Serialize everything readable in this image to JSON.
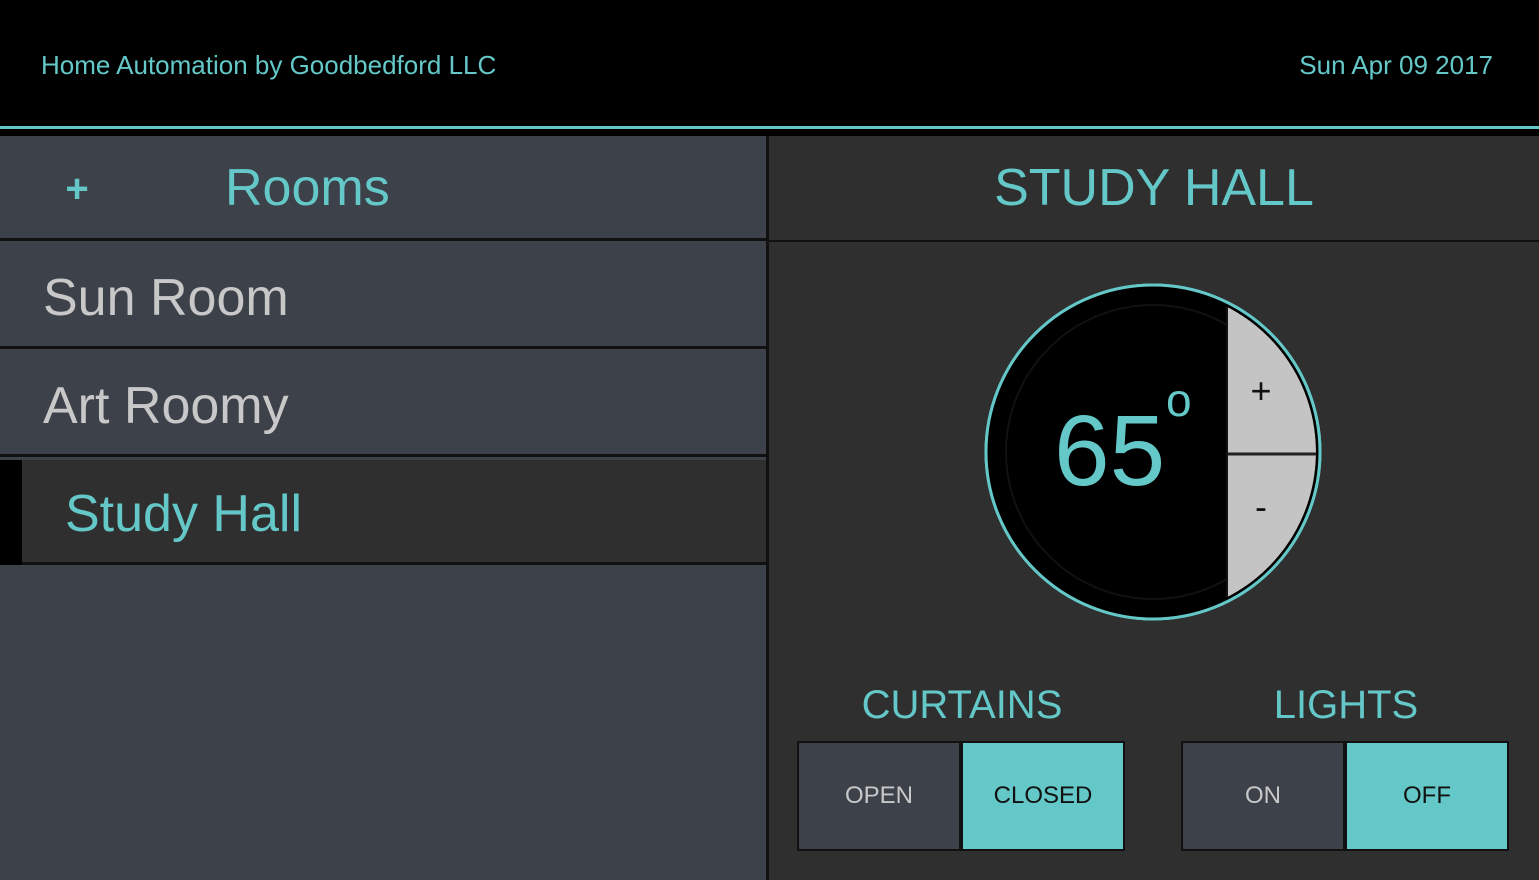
{
  "header": {
    "brand": "Home Automation by Goodbedford LLC",
    "date": "Sun Apr 09 2017"
  },
  "sidebar": {
    "add_label": "+",
    "title": "Rooms",
    "items": [
      {
        "label": "Sun Room",
        "active": false
      },
      {
        "label": "Art Roomy",
        "active": false
      },
      {
        "label": "Study Hall",
        "active": true
      }
    ]
  },
  "main": {
    "room_title": "STUDY HALL",
    "thermostat": {
      "temperature": "65",
      "degree_symbol": "o",
      "increase_label": "+",
      "decrease_label": "-"
    },
    "curtains": {
      "label": "CURTAINS",
      "open_label": "OPEN",
      "closed_label": "CLOSED",
      "selected": "CLOSED"
    },
    "lights": {
      "label": "LIGHTS",
      "on_label": "ON",
      "off_label": "OFF",
      "selected": "OFF"
    }
  },
  "colors": {
    "accent": "#65c8c8",
    "sidebar_bg": "#3d424a",
    "panel_bg": "#2f2f2f",
    "header_bg": "#000000",
    "inactive_text": "#c8c8c8",
    "dial_button_bg": "#c4c4c4"
  }
}
